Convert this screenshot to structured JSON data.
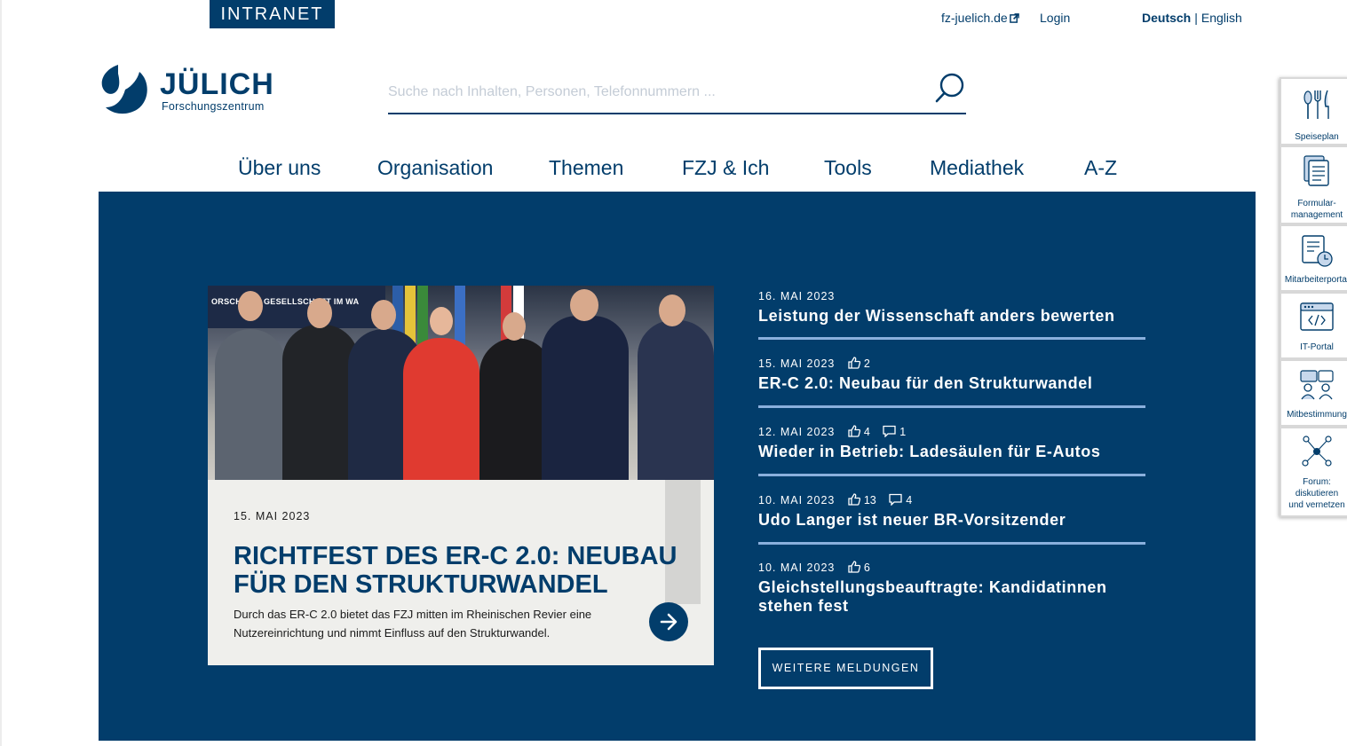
{
  "brand": {
    "intranet_label": "INTRANET",
    "logo_word": "JÜLICH",
    "logo_sub": "Forschungszentrum",
    "primary_color": "#023d6b",
    "accent_color": "#8ab0dd"
  },
  "toplinks": {
    "external_site": "fz-juelich.de",
    "login": "Login",
    "lang_active": "Deutsch",
    "lang_separator": "|",
    "lang_other": "English"
  },
  "search": {
    "placeholder": "Suche nach Inhalten, Personen, Telefonnummern ...",
    "icon": "search-icon"
  },
  "nav": [
    {
      "label": "Über uns"
    },
    {
      "label": "Organisation"
    },
    {
      "label": "Themen"
    },
    {
      "label": "FZJ & Ich"
    },
    {
      "label": "Tools"
    },
    {
      "label": "Mediathek"
    },
    {
      "label": "A-Z"
    }
  ],
  "feature": {
    "photo_banner": "ORSCHE    NE GESELLSCHAFT IM WA",
    "date": "15. MAI 2023",
    "title": "RICHTFEST DES ER-C 2.0: NEUBAU FÜR DEN STRUKTURWANDEL",
    "text": "Durch das ER-C 2.0 bietet das FZJ mitten im Rheinischen Revier eine Nutzereinrichtung und nimmt Einfluss auf den Strukturwandel.",
    "arrow_icon": "arrow-right-icon"
  },
  "news": [
    {
      "date": "16. MAI 2023",
      "likes": "",
      "comments": "",
      "title": "Leistung der Wissenschaft anders bewerten"
    },
    {
      "date": "15. MAI 2023",
      "likes": "2",
      "comments": "",
      "title": "ER-C 2.0: Neubau für den Strukturwandel"
    },
    {
      "date": "12. MAI 2023",
      "likes": "4",
      "comments": "1",
      "title": "Wieder in Betrieb: Ladesäulen für E-Autos"
    },
    {
      "date": "10. MAI 2023",
      "likes": "13",
      "comments": "4",
      "title": "Udo Langer ist neuer BR-Vorsitzender"
    },
    {
      "date": "10. MAI 2023",
      "likes": "6",
      "comments": "",
      "title": "Gleichstellungsbeauftragte: Kandidatinnen stehen fest"
    }
  ],
  "more_button": "WEITERE MELDUNGEN",
  "sidebar": [
    {
      "label": "Speiseplan",
      "icon": "cutlery-icon"
    },
    {
      "label": "Formular-",
      "label2": "management",
      "icon": "form-icon"
    },
    {
      "label": "Mitarbeiterportal",
      "icon": "portal-clock-icon"
    },
    {
      "label": "IT-Portal",
      "icon": "code-window-icon"
    },
    {
      "label": "Mitbestimmung",
      "icon": "people-chat-icon"
    },
    {
      "label": "Forum:",
      "label2": "diskutieren",
      "label3": "und vernetzen",
      "icon": "network-icon"
    }
  ]
}
